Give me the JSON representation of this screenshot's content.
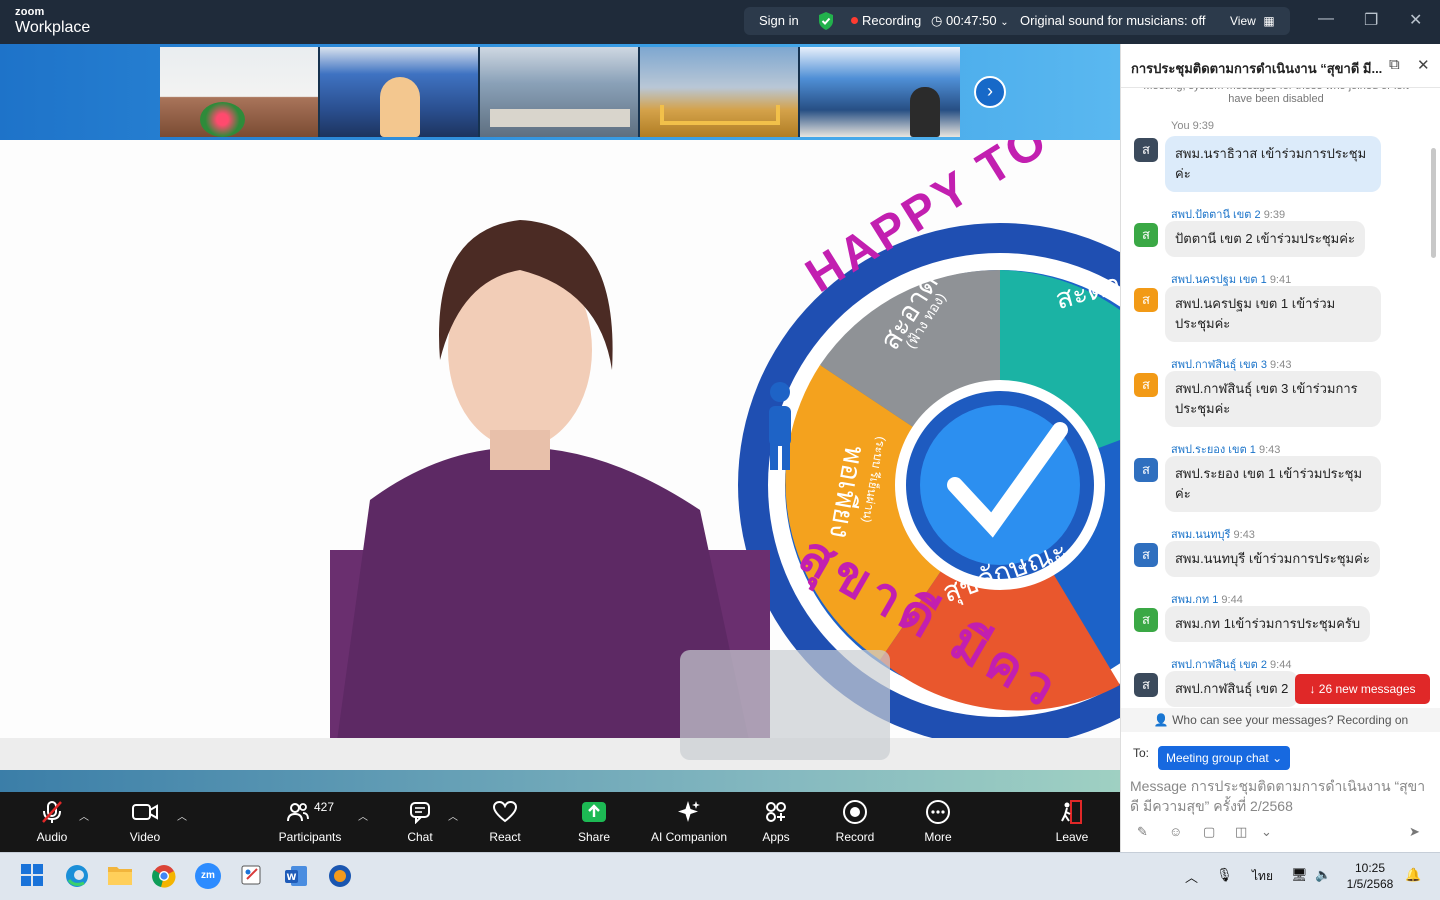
{
  "titlebar": {
    "brand_small": "zoom",
    "brand": "Workplace",
    "sign_in": "Sign in",
    "recording": "Recording",
    "timer": "00:47:50",
    "original_sound": "Original sound for musicians: off",
    "view": "View"
  },
  "toolbar": {
    "audio": "Audio",
    "video": "Video",
    "participants": "Participants",
    "participant_count": "427",
    "chat": "Chat",
    "react": "React",
    "share": "Share",
    "ai_companion": "AI Companion",
    "apps": "Apps",
    "record": "Record",
    "more": "More",
    "leave": "Leave"
  },
  "slide": {
    "banner_text": "HAPPY TO",
    "seg1": "สะอาด",
    "seg1_sub": "(ฟ้าง ทอง)",
    "seg2": "สะดว",
    "seg3": "พอเพียง",
    "seg3_sub": "(ระบบ รีเย็นผ่าน)",
    "seg4": "สุขลักษณะ",
    "bottom_text": "สุขาดี มีคว"
  },
  "chat": {
    "title": "การประชุมติดตามการดำเนินงาน “สุขาดี มี...",
    "system_note": "Meeting, system messages for those who joined or left have been disabled",
    "messages": [
      {
        "sender": "You",
        "time": "9:39",
        "initial": "ส",
        "text": "สพม.นราธิวาส เข้าร่วมการประชุมค่ะ"
      },
      {
        "sender": "สพป.ปัตตานี เขต 2",
        "time": "9:39",
        "initial": "ส",
        "text": "ปัตตานี เขต 2 เข้าร่วมประชุมค่ะ"
      },
      {
        "sender": "สพป.นครปฐม เขต 1",
        "time": "9:41",
        "initial": "ส",
        "text": "สพป.นครปฐม เขต 1 เข้าร่วมประชุมค่ะ"
      },
      {
        "sender": "สพป.กาฬสินธุ์ เขต 3",
        "time": "9:43",
        "initial": "ส",
        "text": "สพป.กาฬสินธุ์ เขต 3 เข้าร่วมการประชุมค่ะ"
      },
      {
        "sender": "สพป.ระยอง เขต 1",
        "time": "9:43",
        "initial": "ส",
        "text": "สพป.ระยอง เขต 1 เข้าร่วมประชุมค่ะ"
      },
      {
        "sender": "สพม.นนทบุรี",
        "time": "9:43",
        "initial": "ส",
        "text": "สพม.นนทบุรี เข้าร่วมการประชุมค่ะ"
      },
      {
        "sender": "สพม.กท 1",
        "time": "9:44",
        "initial": "ส",
        "text": "สพม.กท 1เข้าร่วมการประชุมครับ"
      },
      {
        "sender": "สพป.กาฬสินธุ์ เขต 2",
        "time": "9:44",
        "initial": "ส",
        "text": "สพป.กาฬสินธุ์ เขต 2"
      }
    ],
    "new_messages": "26 new messages",
    "who_can_see": "Who can see your messages? Recording on",
    "to_label": "To:",
    "to_target": "Meeting group chat",
    "input_placeholder": "Message การประชุมติดตามการดำเนินงาน “สุขาดี มีความสุข” ครั้งที่ 2/2568"
  },
  "taskbar": {
    "lang": "ไทย",
    "time": "10:25",
    "date": "1/5/2568"
  },
  "colors": {
    "titlebar": "#1f2b3a",
    "toolbar": "#161616",
    "accent_blue": "#1769e0",
    "record_red": "#e02828",
    "share_green": "#1db954"
  }
}
